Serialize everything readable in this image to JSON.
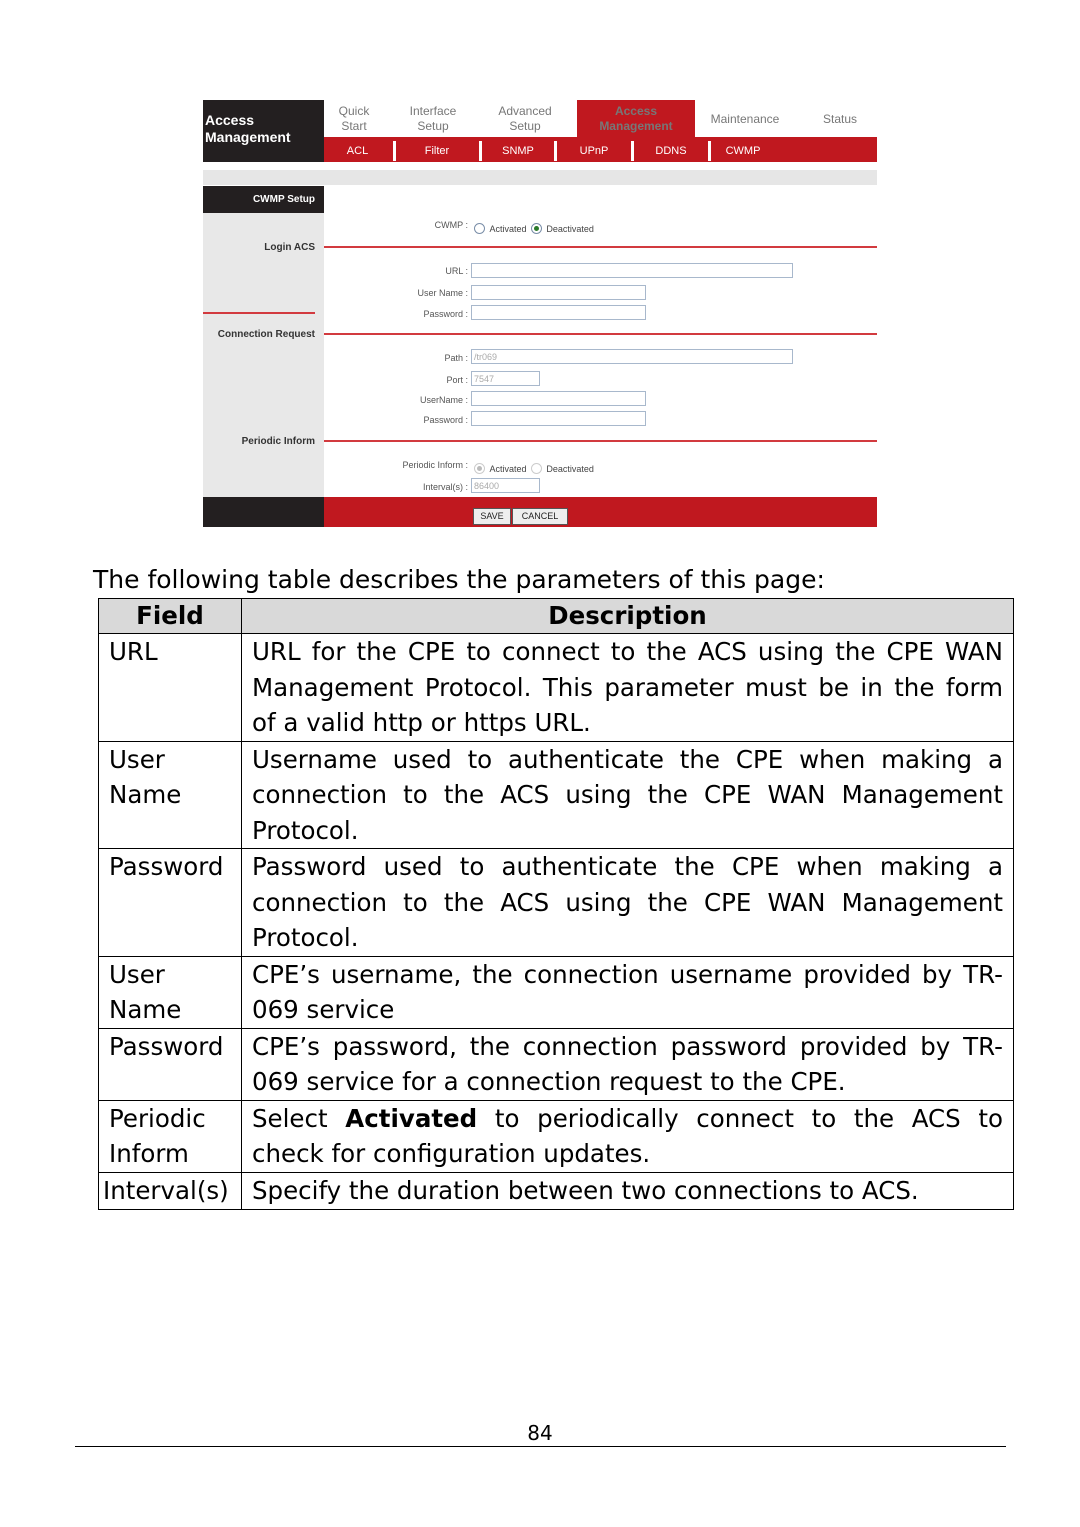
{
  "router_ui": {
    "brand_label": "Access Management",
    "tabs": [
      {
        "label": "Quick Start",
        "active": false
      },
      {
        "label": "Interface Setup",
        "active": false
      },
      {
        "label": "Advanced Setup",
        "active": false
      },
      {
        "label": "Access Management",
        "active": true
      },
      {
        "label": "Maintenance",
        "active": false
      },
      {
        "label": "Status",
        "active": false
      }
    ],
    "subtabs": [
      "ACL",
      "Filter",
      "SNMP",
      "UPnP",
      "DDNS",
      "CWMP"
    ],
    "sidebar": {
      "title": "CWMP Setup",
      "sections": [
        "Login ACS",
        "Connection Request",
        "Periodic Inform"
      ]
    },
    "cwmp": {
      "label": "CWMP :",
      "options": [
        "Activated",
        "Deactivated"
      ],
      "selected": "Deactivated"
    },
    "login_acs": {
      "url_label": "URL :",
      "url_value": "",
      "username_label": "User Name :",
      "username_value": "",
      "password_label": "Password :",
      "password_value": ""
    },
    "connection_request": {
      "path_label": "Path :",
      "path_value": "/tr069",
      "port_label": "Port :",
      "port_value": "7547",
      "username_label": "UserName :",
      "username_value": "",
      "password_label": "Password :",
      "password_value": ""
    },
    "periodic_inform": {
      "label": "Periodic Inform :",
      "options": [
        "Activated",
        "Deactivated"
      ],
      "selected": "Activated",
      "interval_label": "Interval(s) :",
      "interval_value": "86400"
    },
    "save_label": "SAVE",
    "cancel_label": "CANCEL",
    "colors": {
      "brand_red": "#c0181f",
      "dark": "#231f20",
      "sidebar_gray": "#e8e8e8"
    }
  },
  "intro": "The following table describes the parameters of this page:",
  "table": {
    "headers": [
      "Field",
      "Description"
    ],
    "rows": [
      {
        "field": "URL",
        "description": "URL for the CPE to connect to the ACS using the CPE WAN Management Protocol. This parameter must be in the form of a valid http or https URL."
      },
      {
        "field": "User Name",
        "description": "Username used to authenticate the CPE when making a connection to the ACS using the CPE WAN Management Protocol."
      },
      {
        "field": "Password",
        "description": "Password used to authenticate the CPE when making a connection to the ACS using the CPE WAN Management Protocol."
      },
      {
        "field": "User Name",
        "description": "CPE’s username, the connection username provided by TR-069 service"
      },
      {
        "field": "Password",
        "description": "CPE’s password, the connection password provided by TR-069 service for a connection request to the CPE."
      },
      {
        "field": "Periodic Inform",
        "description_pre": "Select ",
        "description_bold": "Activated",
        "description_post": " to periodically connect to the ACS to check for configuration updates."
      },
      {
        "field": "Interval(s)",
        "description": "Specify the duration between two connections to ACS."
      }
    ]
  },
  "page_number": "84"
}
